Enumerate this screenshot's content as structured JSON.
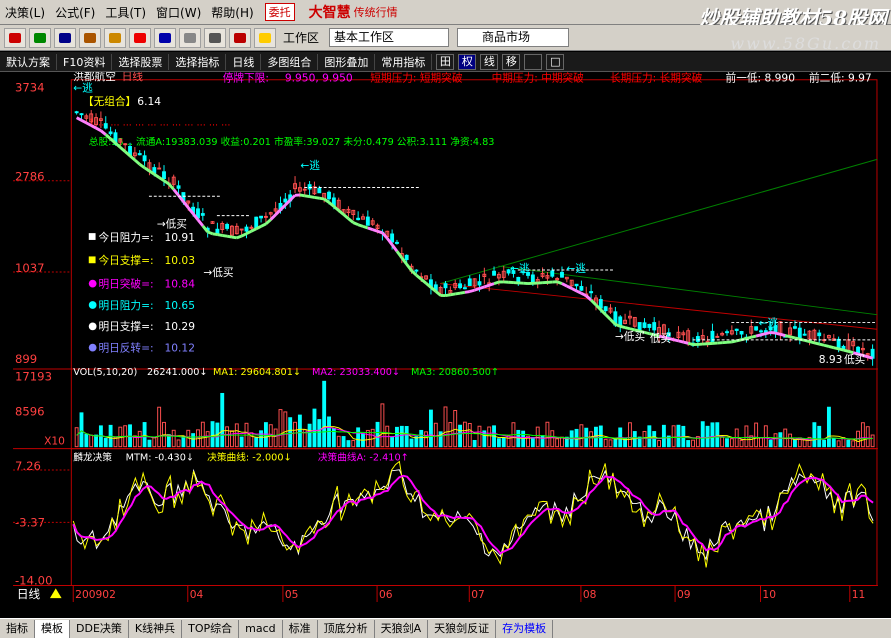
{
  "menu": {
    "items": [
      "决策(L)",
      "公式(F)",
      "工具(T)",
      "窗口(W)",
      "帮助(H)"
    ],
    "trade_label": "委托",
    "brand": "大智慧",
    "brand_sub": "传统行情"
  },
  "watermark": {
    "text": "炒股辅助教材58股网",
    "url": "www.58Gu.com"
  },
  "toolbar": {
    "workspace_label": "工作区",
    "workspace_value": "基本工作区",
    "market_value": "商品市场"
  },
  "toolbar2": {
    "items": [
      "默认方案",
      "F10资料",
      "选择股票",
      "选择指标",
      "日线",
      "多图组合",
      "图形叠加",
      "常用指标"
    ],
    "icons": [
      "田",
      "权",
      "线",
      "移",
      "",
      "□"
    ]
  },
  "stock": {
    "name": "洪都航空",
    "period": "日线",
    "limit_down_label": "停牌下限:",
    "limit_down_values": "9.950, 9.950",
    "short_pressure": "短期压力: 短期突破",
    "mid_pressure": "中期压力: 中期突破",
    "long_pressure": "长期压力: 长期突破",
    "prev_low1": "前一低: 8.990",
    "prev_low2": "前二低: 9.97",
    "no_combo": "【无组合】",
    "no_combo_val": "6.14",
    "red_info": "1 ... ... ... ... ... ... ... ... ... ... ...",
    "fund_info": "总股:35... 流通A:19383.039 收益:0.201 市盈率:39.027 未分:0.479 公积:3.111 净资:4.83"
  },
  "price_axis": [
    "3734",
    "2786",
    "1037",
    "899"
  ],
  "levels": [
    {
      "label": "今日阻力=:",
      "value": "10.91",
      "color": "#ffffff"
    },
    {
      "label": "今日支撑=:",
      "value": "10.03",
      "color": "#ffff00"
    },
    {
      "label": "明日突破=:",
      "value": "10.84",
      "color": "#ff00ff"
    },
    {
      "label": "明日阻力=:",
      "value": "10.65",
      "color": "#00ffff"
    },
    {
      "label": "明日支撑=:",
      "value": "10.29",
      "color": "#ffffff"
    },
    {
      "label": "明日反转=:",
      "value": "10.12",
      "color": "#8080ff"
    }
  ],
  "signals": {
    "escape": "←逃",
    "low_buy": "→低买",
    "low_buy2": "低买",
    "last_price": "8.93"
  },
  "volume": {
    "axis": [
      "17193",
      "8596",
      "X10"
    ],
    "header": "VOL(5,10,20)",
    "vol": "26241.000↓",
    "ma1": "MA1: 29604.801↓",
    "ma2": "MA2: 23033.400↓",
    "ma3": "MA3: 20860.500↑"
  },
  "indicator": {
    "axis": [
      "7.26",
      "-3.37",
      "-14.00"
    ],
    "name": "麟龙决策",
    "mtm": "MTM: -0.430↓",
    "curve": "决策曲线: -2.000↓",
    "curveA": "决策曲线A: -2.410↑"
  },
  "date_axis": {
    "period_label": "日线",
    "labels": [
      "200902",
      "04",
      "05",
      "06",
      "07",
      "08",
      "09",
      "10",
      "11"
    ]
  },
  "bottom_tabs": [
    "指标",
    "模板",
    "DDE决策",
    "K线神兵",
    "TOP综合",
    "macd",
    "标准",
    "顶底分析",
    "天狼剑A",
    "天狼剑反证",
    "存为模板"
  ],
  "colors": {
    "up": "#ff5050",
    "down": "#00ffff",
    "ma_green": "#80ff80",
    "ma_pink": "#ff80ff",
    "axis_red": "#c00000"
  }
}
